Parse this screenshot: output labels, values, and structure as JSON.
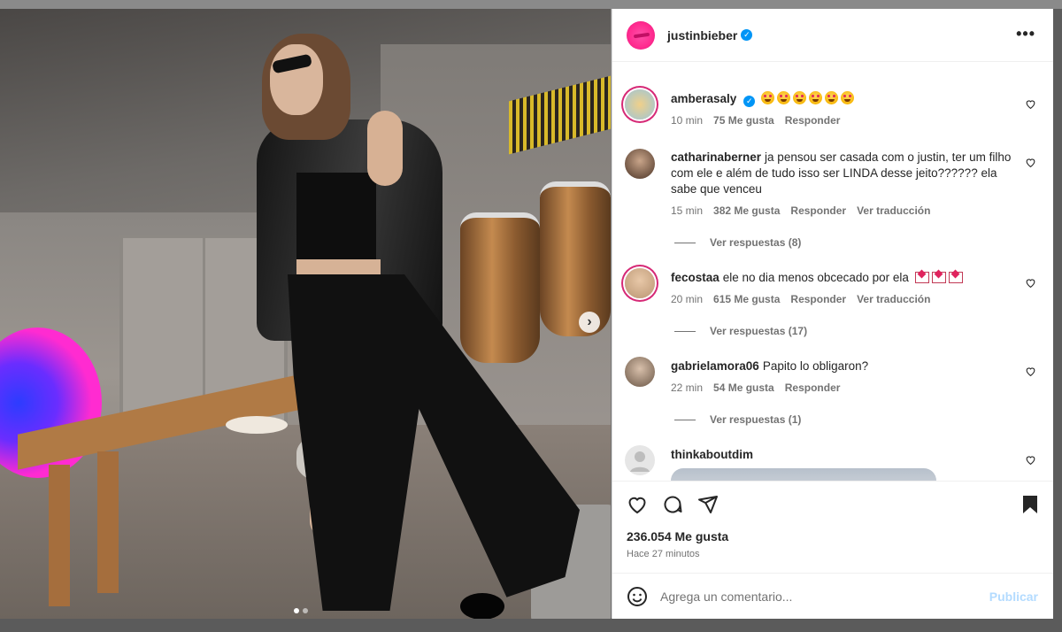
{
  "post": {
    "author": "justinbieber",
    "verified_mark": "✓",
    "more_label": "•••",
    "likes": "236.054 Me gusta",
    "time": "Hace 27 minutos",
    "next_label": "›"
  },
  "comments": [
    {
      "user": "amberasaly",
      "verified": true,
      "text": "",
      "emoji_count": 6,
      "time": "10 min",
      "likes": "75 Me gusta",
      "reply": "Responder",
      "translate": ""
    },
    {
      "user": "catharinaberner",
      "verified": false,
      "text": "ja pensou ser casada com o justin, ter um filho com ele e além de tudo isso ser LINDA desse jeito?????? ela sabe que venceu",
      "time": "15 min",
      "likes": "382 Me gusta",
      "reply": "Responder",
      "translate": "Ver traducción",
      "replies": "Ver respuestas (8)"
    },
    {
      "user": "fecostaa",
      "verified": false,
      "text": "ele no dia menos obcecado por ela",
      "time": "20 min",
      "likes": "615 Me gusta",
      "reply": "Responder",
      "translate": "Ver traducción",
      "replies": "Ver respuestas (17)"
    },
    {
      "user": "gabrielamora06",
      "verified": false,
      "text": "Papito lo obligaron?",
      "time": "22 min",
      "likes": "54 Me gusta",
      "reply": "Responder",
      "replies": "Ver respuestas (1)"
    },
    {
      "user": "thinkaboutdim",
      "verified": false,
      "text": ""
    }
  ],
  "composer": {
    "placeholder": "Agrega un comentario...",
    "publish": "Publicar"
  },
  "colors": {
    "accent": "#0095f6",
    "publish_disabled": "#b3dbff",
    "story_ring": "#d62976"
  },
  "icons": [
    "heart-icon",
    "comment-icon",
    "share-icon",
    "bookmark-icon",
    "emoji-icon",
    "more-icon",
    "chevron-right-icon",
    "verified-icon"
  ]
}
